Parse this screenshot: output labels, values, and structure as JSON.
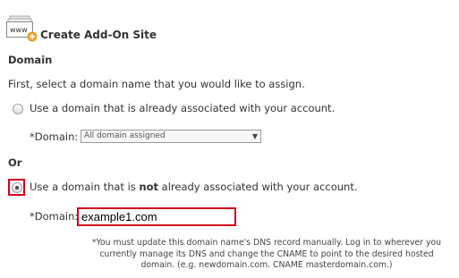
{
  "header": {
    "icon": "www-add-icon",
    "icon_text": "www",
    "title": "Create Add-On Site"
  },
  "domain_section": {
    "heading": "Domain",
    "intro": "First, select a domain name that you would like to assign.",
    "option_existing": {
      "label": "Use a domain that is already associated with your account.",
      "selected": false,
      "field_label": "*Domain:",
      "select_value": "All domain assigned"
    },
    "or_label": "Or",
    "option_new": {
      "label_before": "Use a domain that is ",
      "label_bold": "not",
      "label_after": " already associated with your account.",
      "selected": true,
      "field_label": "*Domain:",
      "input_value": "example1.com"
    },
    "note_lines": [
      "*You must update this domain name's DNS record manually. Log in to wherever you",
      "currently manage its DNS and change the CNAME to point to the desired hosted",
      "domain. (e.g. newdomain.com. CNAME masterdomain.com.)"
    ]
  },
  "colors": {
    "highlight": "#d0021b",
    "add_badge": "#f5a623"
  }
}
